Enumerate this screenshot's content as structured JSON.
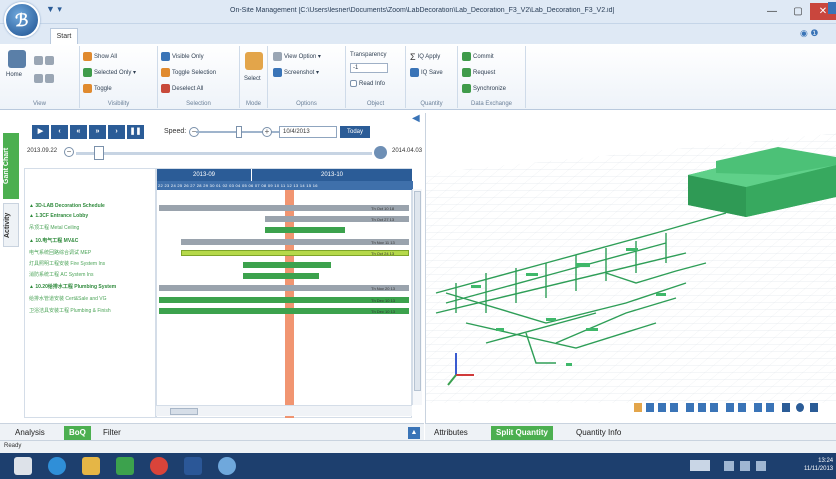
{
  "titlebar": {
    "title": "On-Site Management [C:\\Users\\lesner\\Documents\\Zoom\\LabDecoration\\Lab_Decoration_F3_V2\\Lab_Decoration_F3_V2.id]",
    "qat": "▼ ▾"
  },
  "ribbon": {
    "tab_start": "Start",
    "groups": {
      "view": "View",
      "visibility": "Visibility",
      "selection": "Selection",
      "mode": "Mode",
      "options": "Options",
      "object": "Object",
      "quantity": "Quantity",
      "data_exchange": "Data Exchange"
    },
    "home": "Home",
    "show_all": "Show All",
    "selected_only": "Selected Only ▾",
    "toggle": "Toggle",
    "visible_only": "Visible Only",
    "toggle_selection": "Toggle Selection",
    "deselect_all": "Deselect All",
    "select": "Select",
    "view_option": "View Option ▾",
    "screenshot": "Screenshot ▾",
    "transparency": "Transparency",
    "transparency_value": "-1",
    "read_info": "Read Info",
    "iq_apply": "IQ Apply",
    "iq_save": "IQ Save",
    "commit": "Commit",
    "request": "Request",
    "synchronize": "Synchronize"
  },
  "side_tabs": {
    "gant": "Gant Chart",
    "activity": "Activity"
  },
  "gantt": {
    "speed_label": "Speed:",
    "date": "10/4/2013",
    "today_btn": "Today",
    "range_start": "2013.09.22",
    "range_end": "2014.04.03",
    "months": [
      "2013-09",
      "2013-10"
    ],
    "days": "22 23 24 25 26 27 28 29 30 01 02 03 04 05 06 07 08 09 10 11 12 13 14 15 16",
    "tasks": [
      "▲ 3D-LAB Decoration Schedule",
      "▲ 1.3CF Entrance Lobby",
      "   吊顶工程 Metal Ceiling",
      "▲ 10.电气工程 MV&C",
      "   电气系统回路综合调试 MEP",
      "   灯具照明工程安装 Fire System Ins",
      "   消防系统工程 AC System Ins",
      "▲ 10.20给排水工程 Plumbing System",
      "   给排水管道安装 Cert&Sale and VG",
      "   卫浴洁具安装工程 Plumbing & Finish"
    ],
    "bar_labels": [
      "Th Oct 10 18",
      "Th Oct 27 13",
      "Th Nov 11 13",
      "Th Oct 24 13",
      "Th Nov 20 13",
      "Th Dec 10 13",
      "Th Dec 10 13"
    ]
  },
  "bottom_left_tabs": [
    "Analysis",
    "BoQ",
    "Filter"
  ],
  "bottom_right_tabs": [
    "Attributes",
    "Split Quantity",
    "Quantity Info"
  ],
  "status": "Ready",
  "clock": {
    "time": "13:24",
    "date": "11/11/2013"
  }
}
